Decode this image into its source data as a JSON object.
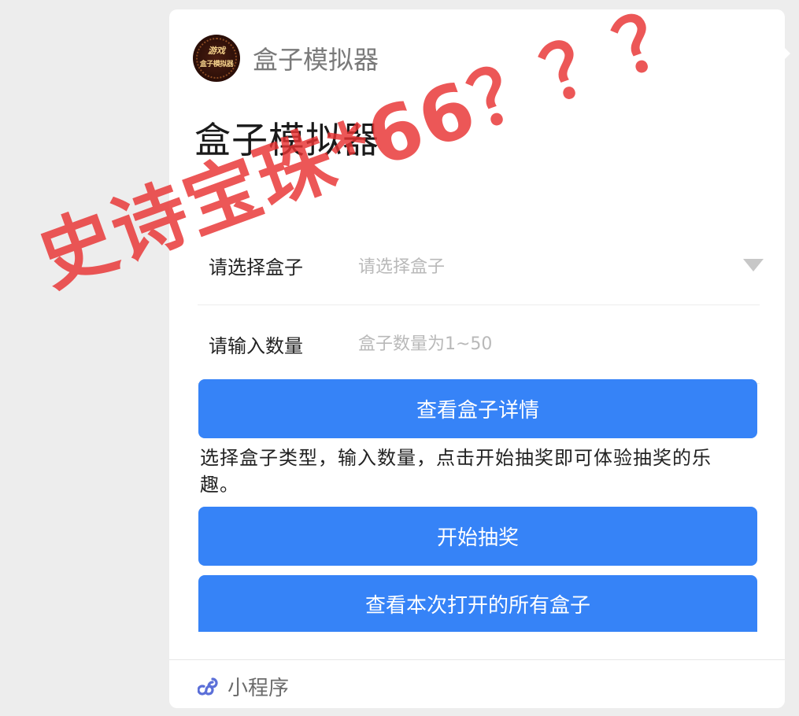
{
  "app": {
    "header_title": "盒子模拟器",
    "avatar_top_text": "游戏",
    "avatar_bottom_text": "盒子模拟器"
  },
  "main": {
    "title": "盒子模拟器",
    "select_label": "请选择盒子",
    "select_placeholder": "请选择盒子",
    "quantity_label": "请输入数量",
    "quantity_placeholder": "盒子数量为1~50",
    "detail_button_label": "查看盒子详情",
    "description": "选择盒子类型，输入数量，点击开始抽奖即可体验抽奖的乐趣。",
    "start_button_label": "开始抽奖",
    "view_all_button_label": "查看本次打开的所有盒子"
  },
  "footer": {
    "label": "小程序",
    "icon": "mini-program-icon"
  },
  "overlay": {
    "text": "史诗宝珠*66？？？"
  },
  "colors": {
    "primary_button": "#3683f7",
    "overlay_text": "#e83232",
    "mini_program_icon": "#5b6fd8"
  }
}
